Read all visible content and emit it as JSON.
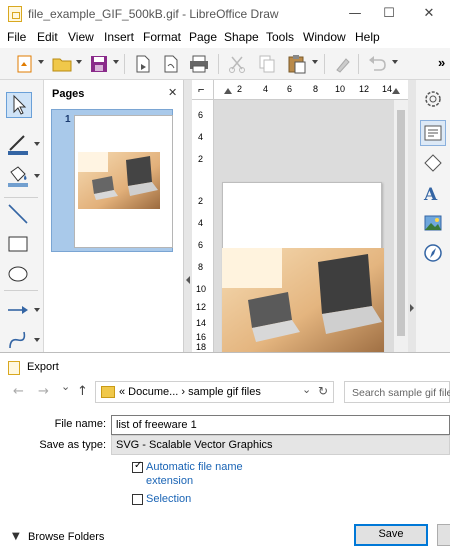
{
  "window": {
    "title": "file_example_GIF_500kB.gif - LibreOffice Draw",
    "minimize": "—",
    "maximize": "☐",
    "close": "✕"
  },
  "menubar": [
    "File",
    "Edit",
    "View",
    "Insert",
    "Format",
    "Page",
    "Shape",
    "Tools",
    "Window",
    "Help"
  ],
  "toolbar": {
    "overflow": "»"
  },
  "pages_panel": {
    "title": "Pages",
    "close": "✕",
    "thumbnail_number": "1"
  },
  "ruler": {
    "horizontal_labels": [
      "2",
      "4",
      "6",
      "8",
      "10",
      "12",
      "14"
    ],
    "vertical_labels": [
      "6",
      "4",
      "2",
      "2",
      "4",
      "6",
      "8",
      "10",
      "12",
      "14",
      "16",
      "18"
    ]
  },
  "export_dialog": {
    "title": "Export",
    "back": "←",
    "forward": "→",
    "recent": "⌄",
    "up": "↑",
    "breadcrumb": "«  Docume...  ›  sample gif files",
    "breadcrumb_dropdown": "⌄",
    "refresh": "↻",
    "search_placeholder": "Search sample gif files",
    "file_name_label": "File name:",
    "file_name_value": "list of freeware 1",
    "save_as_type_label": "Save as type:",
    "save_as_type_value": "SVG - Scalable Vector Graphics",
    "auto_ext_label_line1": "Automatic file name",
    "auto_ext_label_line2": "extension",
    "auto_ext_checked": true,
    "selection_label": "Selection",
    "selection_checked": false,
    "browse_folders": "Browse Folders",
    "save_button": "Save"
  },
  "colors": {
    "accent": "#0078d7",
    "link": "#1a64b5",
    "selection_frame": "#a9c9ea"
  }
}
